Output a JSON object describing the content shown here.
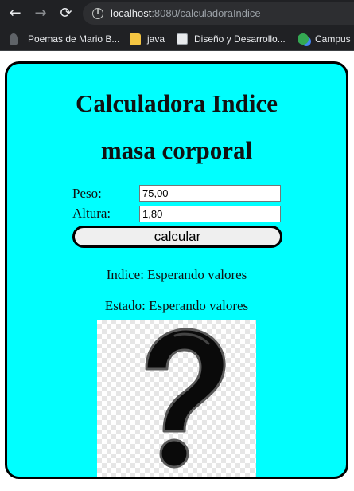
{
  "browser": {
    "url_host": "localhost",
    "url_rest": ":8080/calculadoraIndice",
    "bookmarks": [
      {
        "label": "Poemas de Mario B..."
      },
      {
        "label": "java"
      },
      {
        "label": "Diseño y Desarrollo..."
      },
      {
        "label": "Campus"
      }
    ]
  },
  "form": {
    "title_line1": "Calculadora Indice",
    "title_line2": "masa corporal",
    "peso_label": "Peso:",
    "peso_value": "75,00",
    "altura_label": "Altura:",
    "altura_value": "1,80",
    "button_label": "calcular",
    "indice_text": "Indice: Esperando valores",
    "estado_text": "Estado: Esperando valores"
  },
  "colors": {
    "card_background": "#00ffff",
    "browser_toolbar": "#202124"
  },
  "icons": {
    "back": "arrow-left-icon",
    "forward": "arrow-right-icon",
    "reload": "reload-icon",
    "site_info": "info-icon",
    "result_image": "question-mark-icon"
  }
}
